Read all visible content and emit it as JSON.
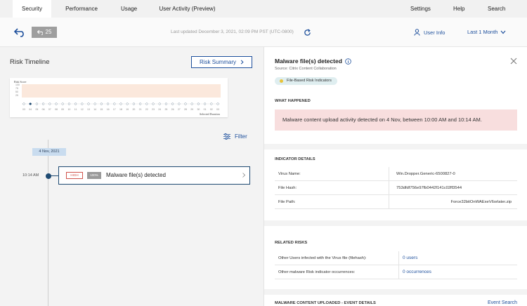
{
  "nav": {
    "tabs": [
      "Security",
      "Performance",
      "Usage",
      "User Activity (Preview)"
    ],
    "right": [
      "Settings",
      "Help",
      "Search"
    ]
  },
  "toolbar": {
    "count": "25",
    "last_updated": "Last updated December 3, 2021, 02:09 PM PST (UTC-0800)",
    "user_info": "User Info",
    "period": "Last 1 Month"
  },
  "timeline": {
    "title": "Risk Timeline",
    "summary_button": "Risk Summary",
    "filter": "Filter",
    "date_chip": "4 Nov, 2021",
    "time": "10:14 AM",
    "mini_chart": {
      "ylabel": "Risk Score",
      "yticks": [
        "100",
        "75",
        "50",
        "25"
      ],
      "xticks": [
        "03",
        "04",
        "05",
        "06",
        "07",
        "08",
        "09",
        "10",
        "11",
        "12",
        "13",
        "14",
        "15",
        "16",
        "17",
        "18",
        "19",
        "20",
        "21",
        "22",
        "23",
        "24",
        "25",
        "26",
        "27",
        "28",
        "29",
        "30",
        "01",
        "02",
        "03"
      ],
      "xlabel": "Selected Duration",
      "highlighted_index": 1
    },
    "event": {
      "severity": "HIGH",
      "score": "100%",
      "title": "Malware file(s) detected"
    }
  },
  "details": {
    "title": "Malware file(s) detected",
    "source": "Source: Citrix Content Collaboration",
    "tag": "File-Based Risk Indicators",
    "what_happened_label": "WHAT HAPPENED",
    "what_happened_text": "Malware content upload activity detected on 4 Nov, between 10:00 AM and 10:14 AM.",
    "indicator_label": "INDICATOR DETAILS",
    "indicators": [
      {
        "key": "Virus Name:",
        "value": "Win.Dropper.Generic-6500827-0"
      },
      {
        "key": "File Hash:",
        "value": "753dfdf756e97fb0442f141c02ff3544"
      },
      {
        "key": "File Path:",
        "value": "Force32bitOnWAExeV6orlater.zip"
      }
    ],
    "related_label": "RELATED RISKS",
    "related": [
      {
        "key": "Other Users infected with the Virus file (filehash):",
        "value": "0 users"
      },
      {
        "key": "Other malware Risk indicator occurrences:",
        "value": "0 occurrences"
      }
    ],
    "event_details_label": "MALWARE CONTENT UPLOADED - EVENT DETAILS",
    "event_search": "Event Search"
  },
  "colors": {
    "accent": "#1d4f9c",
    "danger": "#d0534b",
    "alert_bg": "#f8dede",
    "tag_bg": "#dfeef0",
    "tag_dot": "#e8c43a"
  }
}
